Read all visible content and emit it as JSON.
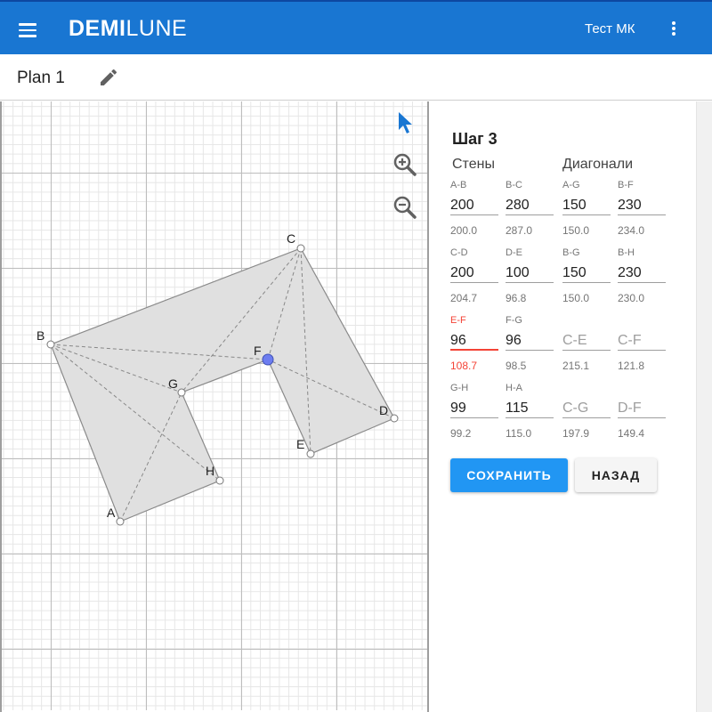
{
  "app": {
    "brand_bold": "DEMI",
    "brand_light": "LUNE",
    "user_name": "Тест МК"
  },
  "plan": {
    "name": "Plan 1"
  },
  "colors": {
    "accent": "#1976d2",
    "button": "#2196f3",
    "error": "#f44336"
  },
  "icons": {
    "menu": "menu-icon",
    "more": "more-vert-icon",
    "edit": "pencil-icon",
    "select": "cursor-icon",
    "zoom_in": "zoom-in-icon",
    "zoom_out": "zoom-out-icon"
  },
  "plan_labels": {
    "A": "A",
    "B": "B",
    "C": "C",
    "D": "D",
    "E": "E",
    "F": "F",
    "G": "G",
    "H": "H"
  },
  "panel": {
    "step_title": "Шаг 3",
    "walls_header": "Стены",
    "diag_header": "Диагонали",
    "fields": [
      {
        "label": "A-B",
        "value": "200",
        "calc": "200.0"
      },
      {
        "label": "B-C",
        "value": "280",
        "calc": "287.0"
      },
      {
        "label": "A-G",
        "value": "150",
        "calc": "150.0"
      },
      {
        "label": "B-F",
        "value": "230",
        "calc": "234.0"
      },
      {
        "label": "C-D",
        "value": "200",
        "calc": "204.7"
      },
      {
        "label": "D-E",
        "value": "100",
        "calc": "96.8"
      },
      {
        "label": "B-G",
        "value": "150",
        "calc": "150.0"
      },
      {
        "label": "B-H",
        "value": "230",
        "calc": "230.0"
      },
      {
        "label": "E-F",
        "value": "96",
        "calc": "108.7",
        "error": true
      },
      {
        "label": "F-G",
        "value": "96",
        "calc": "98.5"
      },
      {
        "label": "",
        "value": "C-E",
        "calc": "215.1",
        "placeholder": true
      },
      {
        "label": "",
        "value": "C-F",
        "calc": "121.8",
        "placeholder": true
      },
      {
        "label": "G-H",
        "value": "99",
        "calc": "99.2"
      },
      {
        "label": "H-A",
        "value": "115",
        "calc": "115.0"
      },
      {
        "label": "",
        "value": "C-G",
        "calc": "197.9",
        "placeholder": true
      },
      {
        "label": "",
        "value": "D-F",
        "calc": "149.4",
        "placeholder": true
      }
    ],
    "save_label": "СОХРАНИТЬ",
    "back_label": "НАЗАД"
  }
}
